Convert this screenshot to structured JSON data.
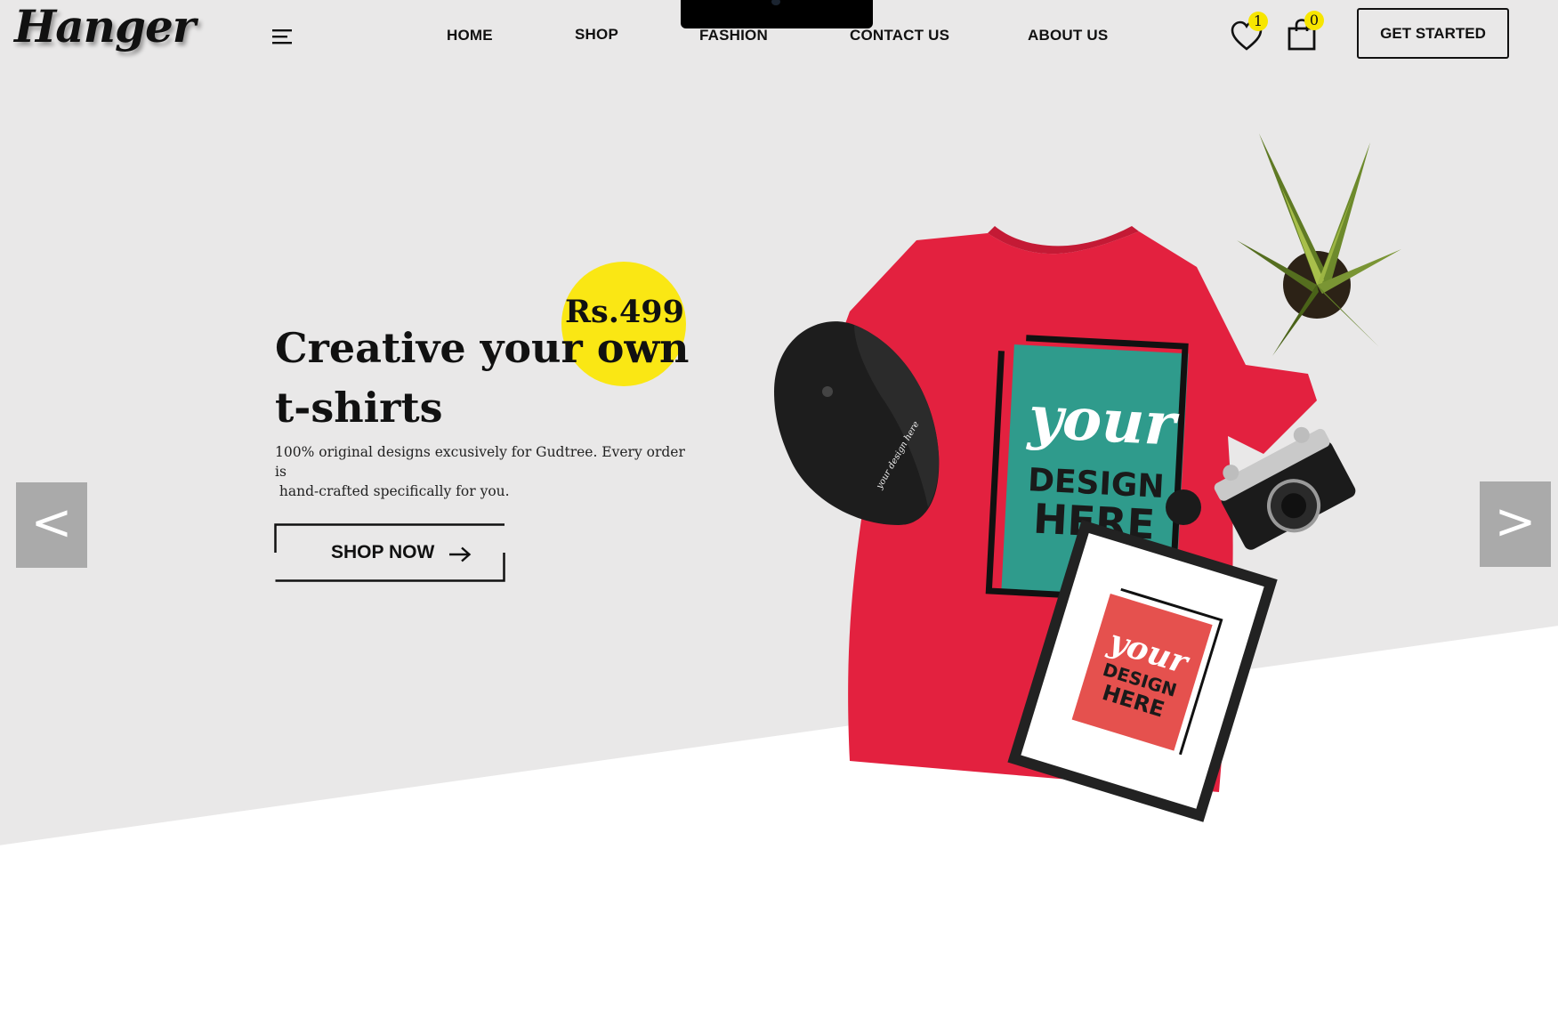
{
  "brand": {
    "logo_text": "Hanger"
  },
  "nav": {
    "items": [
      {
        "label": "HOME"
      },
      {
        "label": "SHOP"
      },
      {
        "label": "FASHION"
      },
      {
        "label": "CONTACT US"
      },
      {
        "label": "ABOUT US"
      }
    ]
  },
  "header": {
    "wishlist_count": "1",
    "cart_count": "0",
    "cta_label": "GET STARTED"
  },
  "hero": {
    "price": "Rs.499",
    "headline_line1": "Creative your own",
    "headline_line2": "t-shirts",
    "description_line1": "100% original designs excusively  for Gudtree. Every order is",
    "description_line2": " hand-crafted specifically for you.",
    "shop_now_label": "SHOP NOW",
    "prev_label": "<",
    "next_label": ">"
  },
  "product_image": {
    "shirt_word_1": "your",
    "shirt_word_2": "DESIGN",
    "shirt_word_3": "HERE",
    "frame_word_1": "your",
    "frame_word_2": "DESIGN",
    "frame_word_3": "HERE",
    "cap_text": "your design here",
    "colors": {
      "shirt": "#e3213f",
      "panel": "#2f9b8c",
      "accent_yellow": "#fae714"
    }
  }
}
